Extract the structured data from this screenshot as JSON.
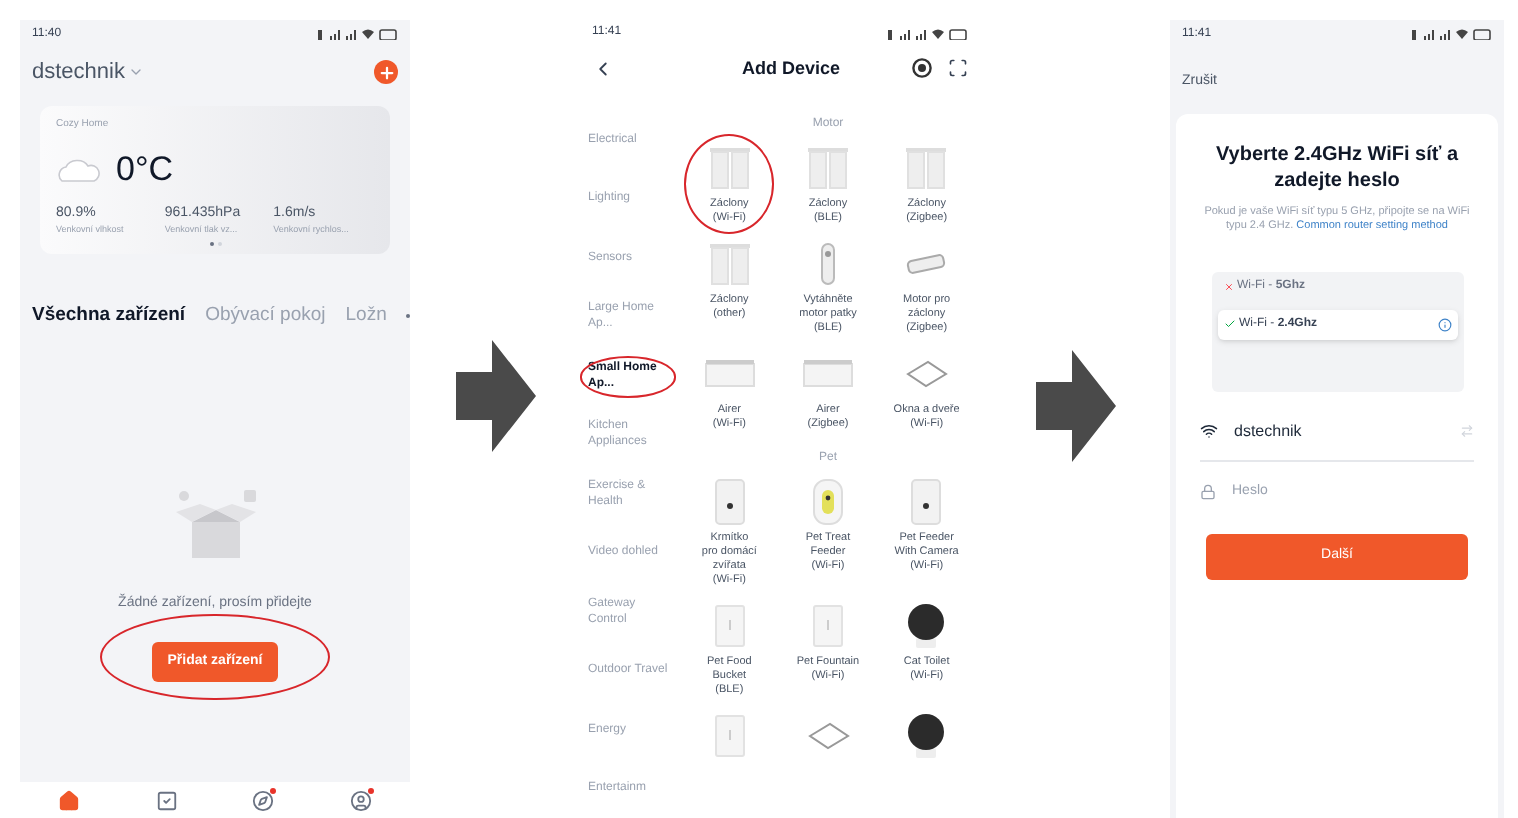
{
  "home_screen": {
    "status_time": "11:40",
    "home_name": "dstechnik",
    "weather": {
      "location": "Cozy Home",
      "temperature": "0°C",
      "stats": [
        {
          "value": "80.9%",
          "label": "Venkovní vlhkost"
        },
        {
          "value": "961.435hPa",
          "label": "Venkovní tlak vz..."
        },
        {
          "value": "1.6m/s",
          "label": "Venkovní rychlos..."
        }
      ],
      "pages": [
        {
          "selected": true
        },
        {
          "selected": false
        }
      ]
    },
    "tabs": [
      {
        "label": "Všechna zařízení",
        "selected": true
      },
      {
        "label": "Obývací pokoj",
        "selected": false
      },
      {
        "label": "Ložn",
        "selected": false
      }
    ],
    "empty_message": "Žádné zařízení, prosím přidejte",
    "add_button": {
      "label": "Přidat zařízení",
      "circled": true
    },
    "nav": [
      {
        "kind": "home",
        "selected": true,
        "badge": false
      },
      {
        "kind": "scene",
        "selected": false,
        "badge": false
      },
      {
        "kind": "explore",
        "selected": false,
        "badge": true
      },
      {
        "kind": "profile",
        "selected": false,
        "badge": true
      }
    ]
  },
  "add_device_screen": {
    "status_time": "11:41",
    "title": "Add Device",
    "categories": [
      {
        "label": "Electrical",
        "selected": false,
        "circled": false
      },
      {
        "label": "Lighting",
        "selected": false,
        "circled": false
      },
      {
        "label": "Sensors",
        "selected": false,
        "circled": false
      },
      {
        "label": "Large Home Ap...",
        "selected": false,
        "circled": false
      },
      {
        "label": "Small Home Ap...",
        "selected": true,
        "circled": true
      },
      {
        "label": "Kitchen Appliances",
        "selected": false,
        "circled": false
      },
      {
        "label": "Exercise & Health",
        "selected": false,
        "circled": false
      },
      {
        "label": "Video dohled",
        "selected": false,
        "circled": false
      },
      {
        "label": "Gateway Control",
        "selected": false,
        "circled": false
      },
      {
        "label": "Outdoor Travel",
        "selected": false,
        "circled": false
      },
      {
        "label": "Energy",
        "selected": false,
        "circled": false
      },
      {
        "label": "Entertainm",
        "selected": false,
        "circled": false
      }
    ],
    "sections": [
      {
        "title": "Motor",
        "items": [
          {
            "kind": "curtain",
            "lines": [
              "Záclony",
              "(Wi-Fi)"
            ],
            "circled": true
          },
          {
            "kind": "curtain",
            "lines": [
              "Záclony",
              "(BLE)"
            ],
            "circled": false
          },
          {
            "kind": "curtain",
            "lines": [
              "Záclony",
              "(Zigbee)"
            ],
            "circled": false
          },
          {
            "kind": "curtain",
            "lines": [
              "Záclony",
              "(other)"
            ],
            "circled": false
          },
          {
            "kind": "stick",
            "lines": [
              "Vytáhněte",
              "motor patky",
              "(BLE)"
            ],
            "circled": false
          },
          {
            "kind": "rail",
            "lines": [
              "Motor pro",
              "záclony",
              "(Zigbee)"
            ],
            "circled": false
          },
          {
            "kind": "airer",
            "lines": [
              "Airer",
              "(Wi-Fi)"
            ],
            "circled": false
          },
          {
            "kind": "airer",
            "lines": [
              "Airer",
              "(Zigbee)"
            ],
            "circled": false
          },
          {
            "kind": "window",
            "lines": [
              "Okna a dveře",
              "(Wi-Fi)"
            ],
            "circled": false
          }
        ]
      },
      {
        "title": "Pet",
        "items": [
          {
            "kind": "feeder",
            "lines": [
              "Krmítko",
              "pro domácí",
              "zvířata",
              "(Wi-Fi)"
            ],
            "circled": false
          },
          {
            "kind": "treat",
            "lines": [
              "Pet Treat",
              "Feeder",
              "(Wi-Fi)"
            ],
            "circled": false
          },
          {
            "kind": "feeder",
            "lines": [
              "Pet Feeder",
              "With Camera",
              "(Wi-Fi)"
            ],
            "circled": false
          },
          {
            "kind": "bucket",
            "lines": [
              "Pet Food",
              "Bucket",
              "(BLE)"
            ],
            "circled": false
          },
          {
            "kind": "bucket",
            "lines": [
              "Pet Fountain",
              "(Wi-Fi)"
            ],
            "circled": false
          },
          {
            "kind": "ball",
            "lines": [
              "Cat Toilet",
              "(Wi-Fi)"
            ],
            "circled": false
          },
          {
            "kind": "bucket",
            "circled": false
          },
          {
            "kind": "window",
            "circled": false
          },
          {
            "kind": "ball",
            "circled": false
          }
        ]
      }
    ]
  },
  "wifi_screen": {
    "status_time": "11:41",
    "cancel": "Zrušit",
    "title": "Vyberte 2.4GHz WiFi síť a zadejte heslo",
    "description": "Pokud je vaše WiFi síť typu 5 GHz, připojte se na WiFi typu 2.4 GHz.",
    "link": "Common router setting method",
    "networks": [
      {
        "label": "Wi-Fi - **5Ghz**",
        "supported": false
      },
      {
        "label": "Wi-Fi - **2.4Ghz**",
        "supported": true
      }
    ],
    "ssid": "dstechnik",
    "password_placeholder": "Heslo",
    "next_button": "Další"
  }
}
